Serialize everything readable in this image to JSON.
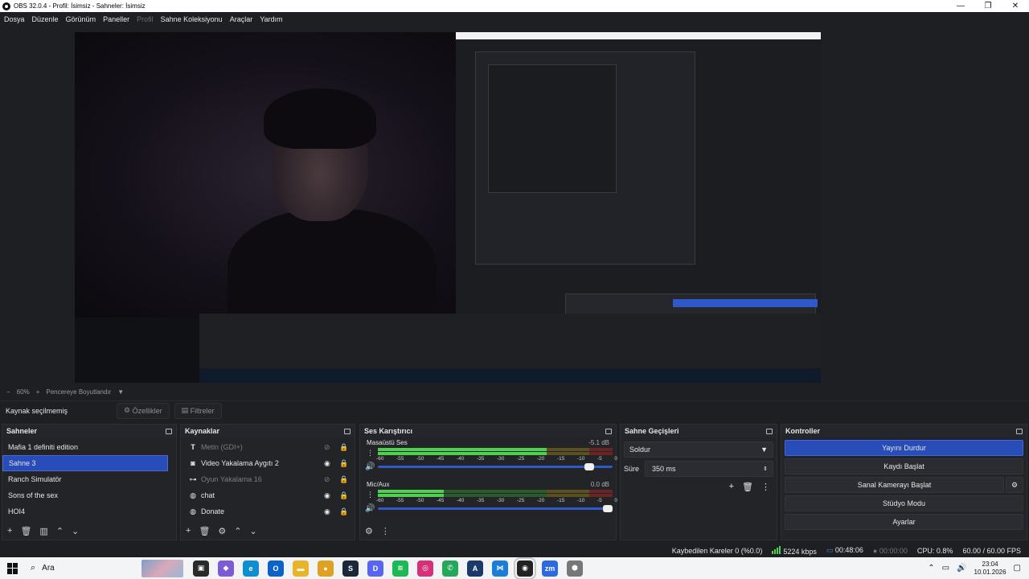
{
  "window": {
    "title": "OBS 32.0.4 - Profil: İsimsiz - Sahneler: İsimsiz",
    "controls": [
      "—",
      "❐",
      "✕"
    ]
  },
  "menu": {
    "items": [
      "Dosya",
      "Düzenle",
      "Görünüm",
      "Paneller",
      "Profil",
      "Sahne Koleksiyonu",
      "Araçlar",
      "Yardım"
    ]
  },
  "preview": {
    "zoom": "60%",
    "fit_label": "Pencereye Boyutlandır"
  },
  "source_toolbar": {
    "status": "Kaynak seçilmemiş",
    "properties": "Özellikler",
    "filters": "Filtreler"
  },
  "scenes": {
    "title": "Sahneler",
    "items": [
      "Mafia 1 definiti edition",
      "Sahne 3",
      "Ranch Simulatör",
      "Sons of the sex",
      "HOI4"
    ],
    "selected_index": 1
  },
  "sources": {
    "title": "Kaynaklar",
    "items": [
      {
        "label": "Metin (GDI+)",
        "icon": "text-icon",
        "visible": false
      },
      {
        "label": "Video Yakalama Aygıtı 2",
        "icon": "camera-icon",
        "visible": true
      },
      {
        "label": "Oyun Yakalama 16",
        "icon": "gamepad-icon",
        "visible": false
      },
      {
        "label": "chat",
        "icon": "browser-icon",
        "visible": true
      },
      {
        "label": "Donate",
        "icon": "browser-icon",
        "visible": true
      }
    ]
  },
  "mixer": {
    "title": "Ses Karıştırıcı",
    "channels": [
      {
        "name": "Masaüstü Ses",
        "db": "-5.1 dB",
        "level": 0.72,
        "volume": 0.92
      },
      {
        "name": "Mic/Aux",
        "db": "0.0 dB",
        "level": 0.28,
        "volume": 1.0
      }
    ],
    "ticks": [
      "-60",
      "-55",
      "-50",
      "-45",
      "-40",
      "-35",
      "-30",
      "-25",
      "-20",
      "-15",
      "-10",
      "-5",
      "0"
    ]
  },
  "transitions": {
    "title": "Sahne Geçişleri",
    "selected": "Soldur",
    "duration_label": "Süre",
    "duration_value": "350 ms"
  },
  "controls": {
    "title": "Kontroller",
    "stop_stream": "Yayını Durdur",
    "start_record": "Kaydı Başlat",
    "virtual_cam": "Sanal Kamerayı Başlat",
    "studio_mode": "Stüdyo Modu",
    "settings": "Ayarlar"
  },
  "stats": {
    "dropped_frames": "Kaybedilen Kareler 0 (%0.0)",
    "bitrate": "5224 kbps",
    "stream_time": "00:48:06",
    "record_time": "00:00:00",
    "cpu": "CPU: 0.8%",
    "fps": "60.00 / 60.00 FPS"
  },
  "taskbar": {
    "search_placeholder": "Ara",
    "time": "23:04",
    "date": "10.01.2026",
    "apps": [
      {
        "name": "task-view-icon",
        "color": "#2a2a2a",
        "glyph": "▣"
      },
      {
        "name": "copilot-icon",
        "color": "#7b5bd6",
        "glyph": "◆"
      },
      {
        "name": "edge-icon",
        "color": "#0f8fd1",
        "glyph": "e"
      },
      {
        "name": "outlook-icon",
        "color": "#0a64c8",
        "glyph": "O"
      },
      {
        "name": "file-explorer-icon",
        "color": "#e8b42a",
        "glyph": "▬"
      },
      {
        "name": "chrome-icon",
        "color": "#e0a020",
        "glyph": "●"
      },
      {
        "name": "steam-icon",
        "color": "#1b2838",
        "glyph": "S"
      },
      {
        "name": "discord-icon",
        "color": "#5865f2",
        "glyph": "D"
      },
      {
        "name": "spotify-icon",
        "color": "#1db954",
        "glyph": "≋"
      },
      {
        "name": "instagram-icon",
        "color": "#d6307a",
        "glyph": "◎"
      },
      {
        "name": "whatsapp-icon",
        "color": "#25a85a",
        "glyph": "✆"
      },
      {
        "name": "app-a-icon",
        "color": "#1a3a6a",
        "glyph": "A"
      },
      {
        "name": "vscode-icon",
        "color": "#1a7fd4",
        "glyph": "⋈"
      },
      {
        "name": "obs-icon",
        "color": "#222222",
        "glyph": "◉"
      },
      {
        "name": "zoom-icon",
        "color": "#2d6ae0",
        "glyph": "zm"
      },
      {
        "name": "shield-app-icon",
        "color": "#777777",
        "glyph": "⬢"
      }
    ]
  }
}
